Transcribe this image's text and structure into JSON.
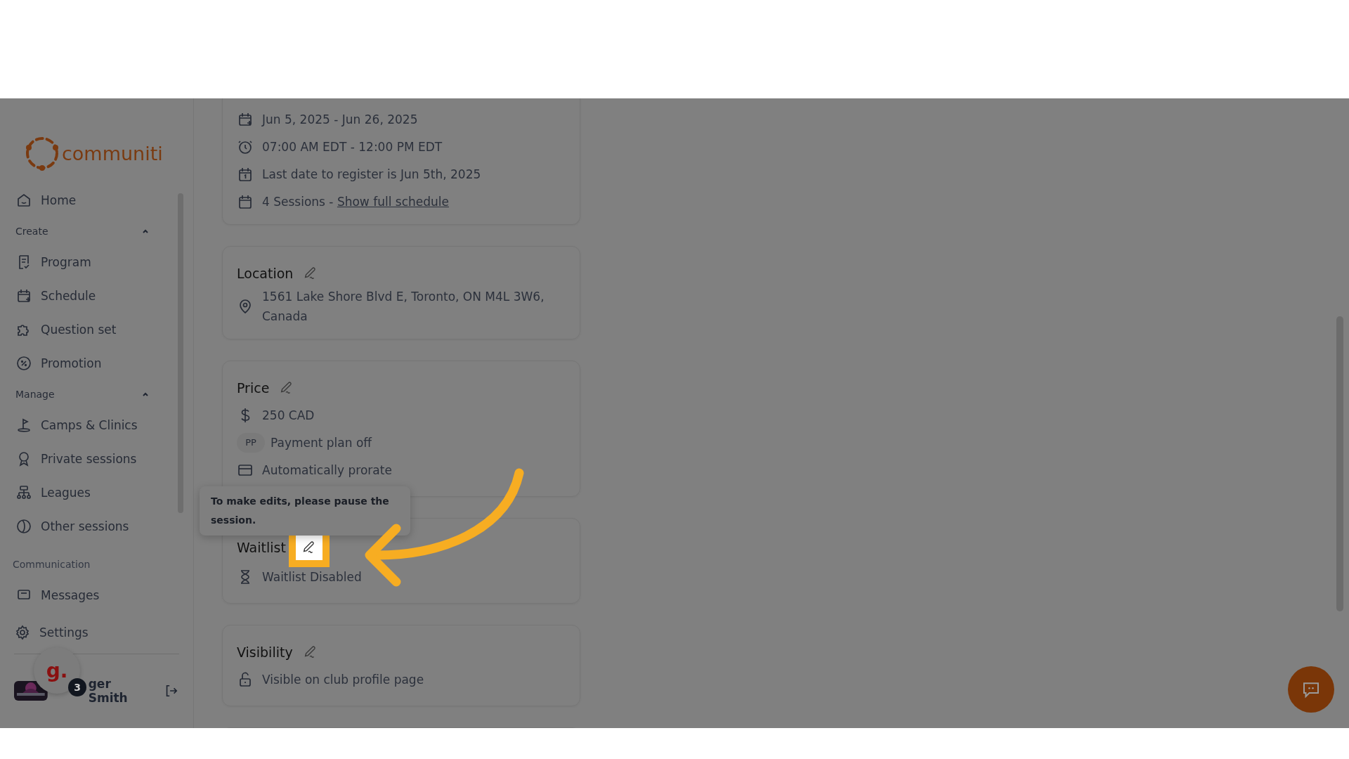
{
  "sidebar": {
    "logo": "communiti",
    "items": [
      {
        "kind": "link",
        "label": "Home"
      },
      {
        "kind": "section",
        "label": "Create",
        "expanded": true
      },
      {
        "kind": "link",
        "label": "Program"
      },
      {
        "kind": "link",
        "label": "Schedule"
      },
      {
        "kind": "link",
        "label": "Question set"
      },
      {
        "kind": "link",
        "label": "Promotion"
      },
      {
        "kind": "section",
        "label": "Manage",
        "expanded": true
      },
      {
        "kind": "link",
        "label": "Camps & Clinics"
      },
      {
        "kind": "link",
        "label": "Private sessions"
      },
      {
        "kind": "link",
        "label": "Leagues"
      },
      {
        "kind": "link",
        "label": "Other sessions"
      },
      {
        "kind": "label",
        "label": "Communication"
      },
      {
        "kind": "link",
        "label": "Messages"
      }
    ],
    "settings": "Settings",
    "user_name": "ger Smith"
  },
  "cards": [
    {
      "rows": [
        {
          "kind": "text",
          "text": "Jun 5, 2025 - Jun 26, 2025"
        },
        {
          "kind": "text",
          "text": "07:00 AM EDT - 12:00 PM EDT"
        },
        {
          "kind": "text",
          "text": "Last date to register is Jun 5th, 2025"
        },
        {
          "kind": "link",
          "text": "4 Sessions - ",
          "link": "Show full schedule"
        }
      ]
    },
    {
      "title": "Location",
      "highlighted": false,
      "rows": [
        {
          "kind": "text",
          "text": "1561 Lake Shore Blvd E, Toronto, ON M4L 3W6, Canada"
        }
      ]
    },
    {
      "title": "Price",
      "highlighted": false,
      "rows": [
        {
          "kind": "text",
          "text": "250 CAD"
        },
        {
          "kind": "badge",
          "badge": "PP",
          "text": "Payment plan off"
        },
        {
          "kind": "text",
          "text": "Automatically prorate"
        }
      ]
    },
    {
      "title": "Waitlist",
      "highlighted": true,
      "rows": [
        {
          "kind": "text",
          "text": "Waitlist Disabled"
        }
      ]
    },
    {
      "title": "Visibility",
      "highlighted": false,
      "rows": [
        {
          "kind": "text",
          "text": "Visible on club profile page"
        }
      ]
    }
  ],
  "tooltip": "To make edits, please pause the session.",
  "help_widget": {
    "logo": "g.",
    "badge": "3"
  }
}
